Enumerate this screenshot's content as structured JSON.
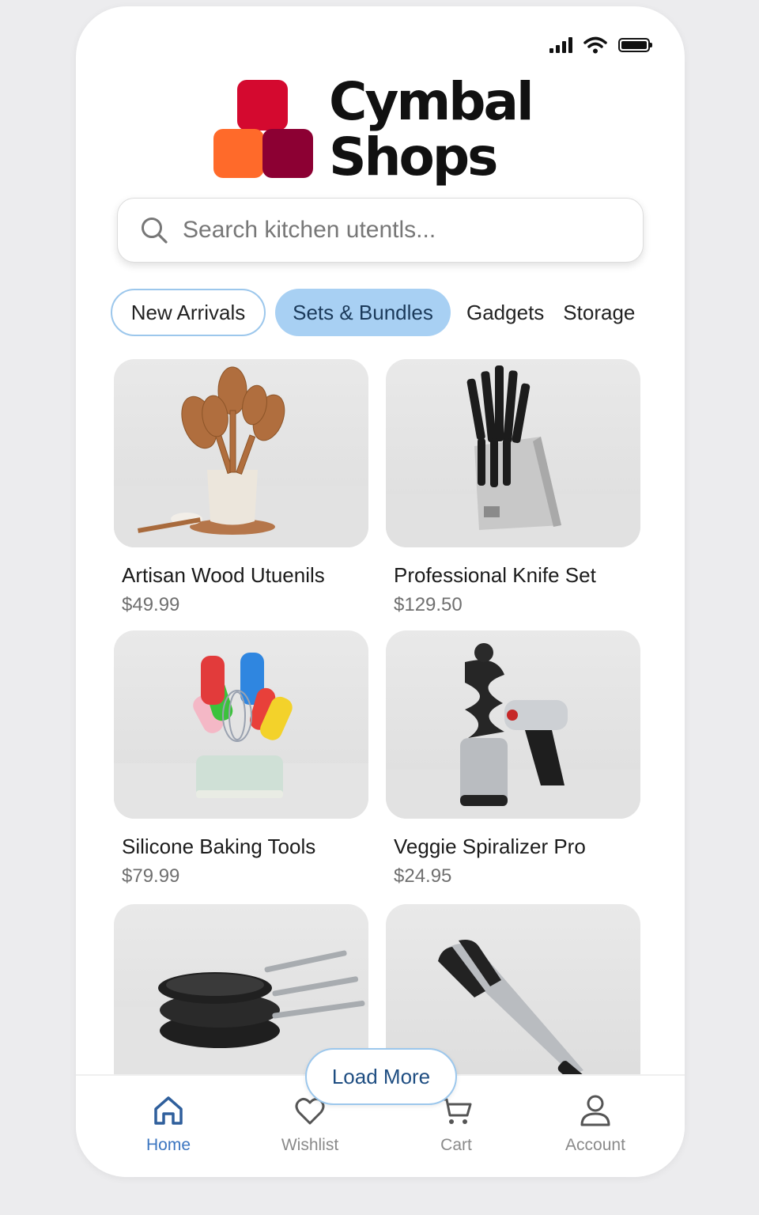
{
  "brand": {
    "line1": "Cymbal",
    "line2": "Shops",
    "colors": {
      "red": "#d4092f",
      "orange": "#ff6a2a",
      "maroon": "#8c0033"
    }
  },
  "status_bar": {
    "icons": [
      "signal-icon",
      "wifi-icon",
      "battery-icon"
    ]
  },
  "search": {
    "placeholder": "Search kitchen utentls..."
  },
  "categories": [
    {
      "label": "New Arrivals",
      "state": "outlined"
    },
    {
      "label": "Sets & Bundles",
      "state": "selected"
    },
    {
      "label": "Gadgets",
      "state": "plain"
    },
    {
      "label": "Storage",
      "state": "plain"
    }
  ],
  "products": [
    {
      "title": "Artisan Wood Utuenils",
      "price": "$49.99",
      "image": "wooden-spoons-image"
    },
    {
      "title": "Professional Knife Set",
      "price": "$129.50",
      "image": "knife-block-image"
    },
    {
      "title": "Silicone Baking Tools",
      "price": "$79.99",
      "image": "silicone-tools-image"
    },
    {
      "title": "Veggie Spiralizer Pro",
      "price": "$24.95",
      "image": "spiralizer-image"
    },
    {
      "title": "",
      "price": "",
      "image": "frying-pans-image"
    },
    {
      "title": "",
      "price": "",
      "image": "tongs-image"
    }
  ],
  "load_more": {
    "label": "Load More"
  },
  "bottom_nav": [
    {
      "label": "Home",
      "icon": "home-icon",
      "active": true
    },
    {
      "label": "Wishlist",
      "icon": "heart-icon",
      "active": false
    },
    {
      "label": "Cart",
      "icon": "cart-icon",
      "active": false
    },
    {
      "label": "Account",
      "icon": "user-icon",
      "active": false
    }
  ],
  "accent_color": "#3b75c0"
}
